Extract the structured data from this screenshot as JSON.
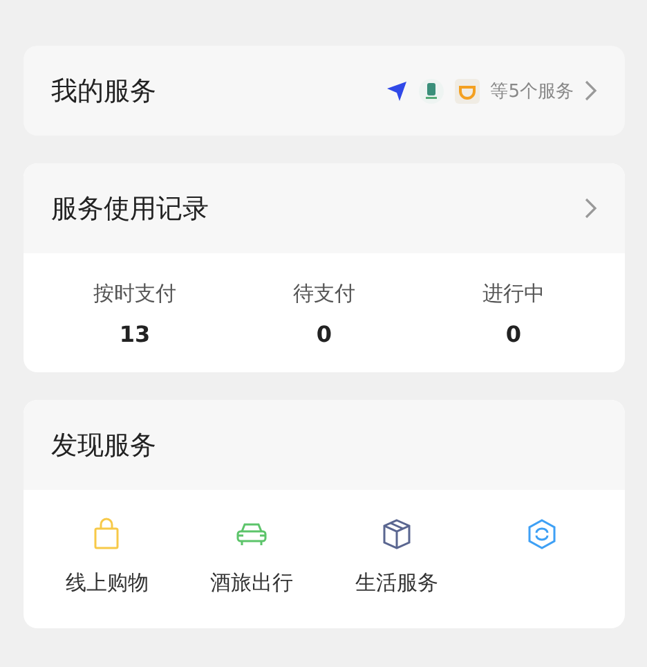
{
  "my_services": {
    "title": "我的服务",
    "summary": "等5个服务",
    "app_icons": [
      {
        "kind": "plane"
      },
      {
        "kind": "bottle"
      },
      {
        "kind": "cup"
      }
    ]
  },
  "usage_records": {
    "title": "服务使用记录",
    "stats": [
      {
        "label": "按时支付",
        "value": "13"
      },
      {
        "label": "待支付",
        "value": "0"
      },
      {
        "label": "进行中",
        "value": "0"
      }
    ]
  },
  "discover": {
    "title": "发现服务",
    "items": [
      {
        "label": "线上购物",
        "kind": "bag",
        "color": "#f7c948"
      },
      {
        "label": "酒旅出行",
        "kind": "car",
        "color": "#5cc46a"
      },
      {
        "label": "生活服务",
        "kind": "box",
        "color": "#5a6690"
      },
      {
        "kind": "loop",
        "color": "#3ea0f5"
      }
    ]
  }
}
